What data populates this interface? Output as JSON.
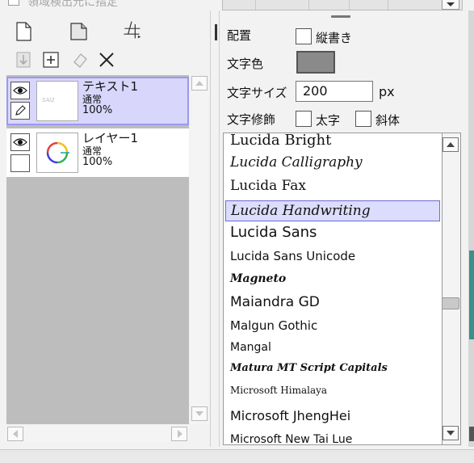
{
  "top": {
    "checkbox_label": "領域検出元に指定"
  },
  "layers": [
    {
      "name": "テキスト1",
      "mode": "通常",
      "opacity": "100%",
      "thumb_text": "SAI2",
      "selected": true
    },
    {
      "name": "レイヤー1",
      "mode": "通常",
      "opacity": "100%",
      "thumb_text": "",
      "selected": false
    }
  ],
  "text_tool": {
    "placement_label": "配置",
    "vertical_label": "縦書き",
    "color_label": "文字色",
    "color_value": "#8a8a8a",
    "size_label": "文字サイズ",
    "size_value": "200",
    "size_unit": "px",
    "decoration_label": "文字修飾",
    "bold_label": "太字",
    "italic_label": "斜体"
  },
  "fonts": [
    {
      "name": "Lucida Bright",
      "selected": false
    },
    {
      "name": "Lucida Calligraphy",
      "selected": false
    },
    {
      "name": "Lucida Fax",
      "selected": false
    },
    {
      "name": "Lucida Handwriting",
      "selected": true
    },
    {
      "name": "Lucida Sans",
      "selected": false
    },
    {
      "name": "Lucida Sans Unicode",
      "selected": false
    },
    {
      "name": "Magneto",
      "selected": false
    },
    {
      "name": "Maiandra GD",
      "selected": false
    },
    {
      "name": "Malgun Gothic",
      "selected": false
    },
    {
      "name": "Mangal",
      "selected": false
    },
    {
      "name": "Matura MT Script Capitals",
      "selected": false
    },
    {
      "name": "Microsoft Himalaya",
      "selected": false
    },
    {
      "name": "Microsoft JhengHei",
      "selected": false
    },
    {
      "name": "Microsoft New Tai Lue",
      "selected": false
    }
  ],
  "colors": {
    "selection_fill": "#d8d6fb",
    "selection_border": "#9b98f0",
    "accent": "#3c8f8a"
  }
}
